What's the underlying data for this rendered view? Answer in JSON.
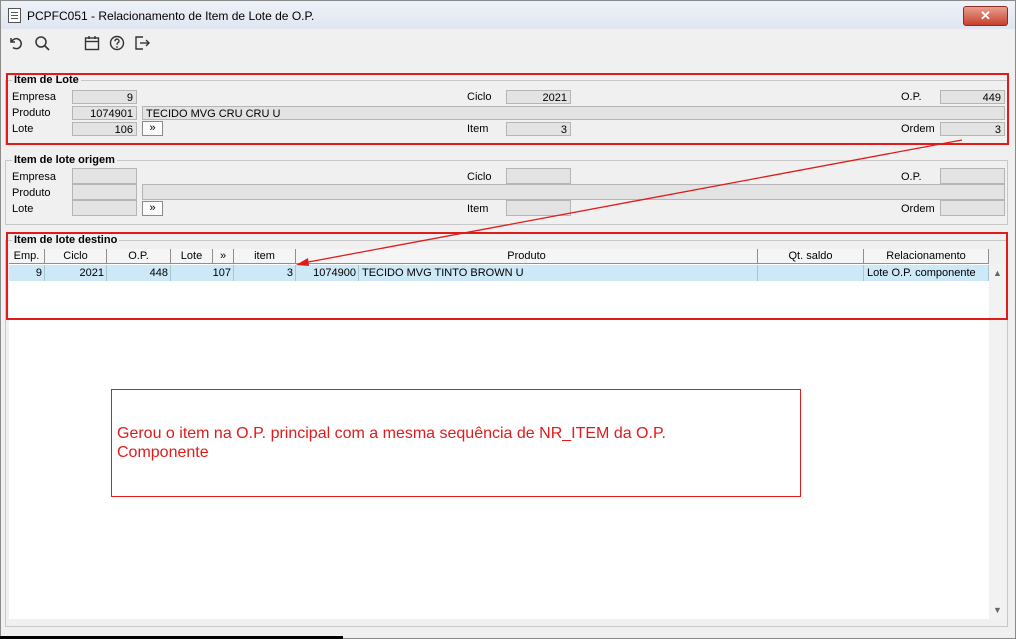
{
  "window": {
    "title": "PCPFC051 - Relacionamento de Item de Lote de O.P.",
    "close_glyph": "✕"
  },
  "toolbar": {
    "icons": [
      "undo-icon",
      "search-icon",
      "calendar-icon",
      "help-icon",
      "exit-icon"
    ]
  },
  "item_lote": {
    "legend": "Item de Lote",
    "empresa_label": "Empresa",
    "empresa": "9",
    "ciclo_label": "Ciclo",
    "ciclo": "2021",
    "op_label": "O.P.",
    "op": "449",
    "produto_label": "Produto",
    "produto_code": "1074901",
    "produto_desc": "TECIDO MVG CRU CRU U",
    "lote_label": "Lote",
    "lote": "106",
    "lote_button": "»",
    "item_label": "Item",
    "item": "3",
    "ordem_label": "Ordem",
    "ordem": "3"
  },
  "item_origem": {
    "legend": "Item de lote origem",
    "empresa_label": "Empresa",
    "ciclo_label": "Ciclo",
    "op_label": "O.P.",
    "produto_label": "Produto",
    "lote_label": "Lote",
    "lote_button": "»",
    "item_label": "Item",
    "ordem_label": "Ordem"
  },
  "item_destino": {
    "legend": "Item de lote destino",
    "columns": [
      "Emp.",
      "Ciclo",
      "O.P.",
      "Lote",
      "»",
      "item",
      "Produto",
      "Qt. saldo",
      "Relacionamento"
    ],
    "rows": [
      {
        "emp": "9",
        "ciclo": "2021",
        "op": "448",
        "lote": "107",
        "item": "3",
        "produto_code": "1074900",
        "produto_desc": "TECIDO MVG TINTO BROWN U",
        "qt_saldo": "",
        "relacionamento": "Lote O.P. componente"
      }
    ]
  },
  "annotation": {
    "line1": "Gerou o item na O.P. principal com a mesma sequência de NR_ITEM da O.P.",
    "line2": "Componente"
  },
  "colors": {
    "highlight": "#e01b1b",
    "selected_row": "#cde8f7"
  }
}
